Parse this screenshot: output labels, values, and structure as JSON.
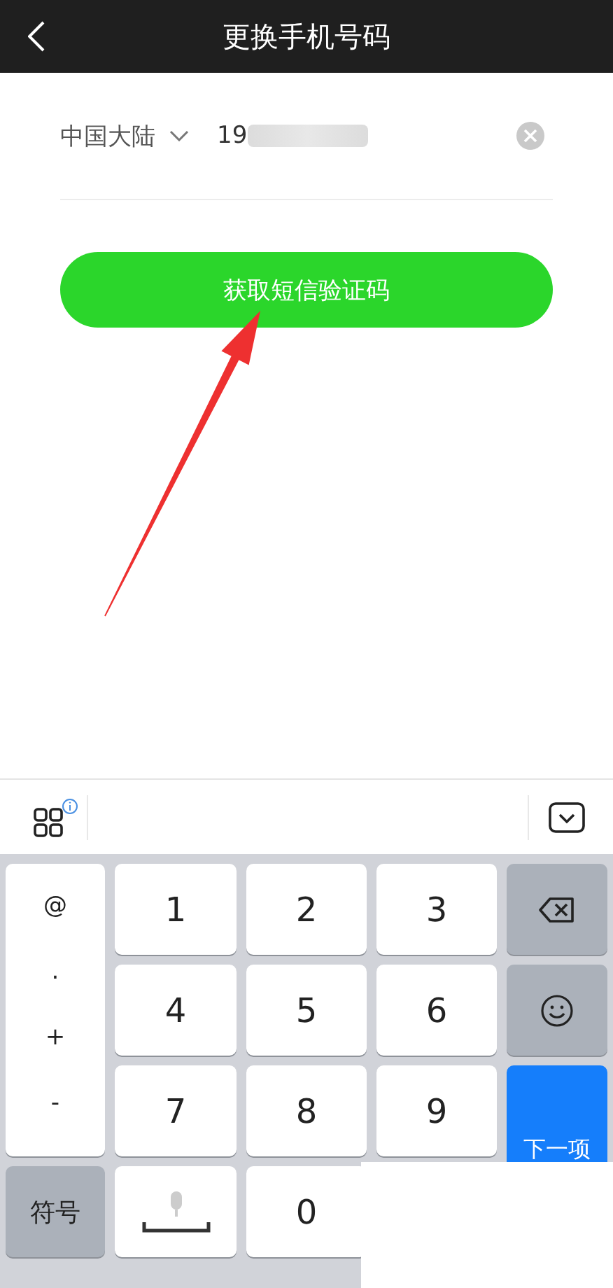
{
  "header": {
    "title": "更换手机号码"
  },
  "phone_form": {
    "region": "中国大陆",
    "phone_value": "19",
    "button": "获取短信验证码"
  },
  "keyboard": {
    "keys": [
      {
        "kind": "symbols",
        "symbols": [
          "@",
          ".",
          "+",
          "-"
        ]
      },
      {
        "kind": "digit",
        "label": "1"
      },
      {
        "kind": "digit",
        "label": "2"
      },
      {
        "kind": "digit",
        "label": "3"
      },
      {
        "kind": "delete"
      },
      {
        "kind": "digit",
        "label": "4"
      },
      {
        "kind": "digit",
        "label": "5"
      },
      {
        "kind": "digit",
        "label": "6"
      },
      {
        "kind": "emoji"
      },
      {
        "kind": "digit",
        "label": "7"
      },
      {
        "kind": "digit",
        "label": "8"
      },
      {
        "kind": "digit",
        "label": "9"
      },
      {
        "kind": "next",
        "label": "下一项"
      },
      {
        "kind": "switch",
        "label": "符号"
      },
      {
        "kind": "space"
      },
      {
        "kind": "digit",
        "label": "0"
      }
    ]
  }
}
